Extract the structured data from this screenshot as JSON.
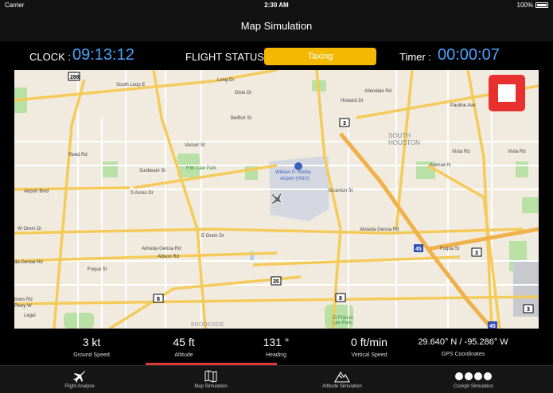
{
  "status_bar": {
    "carrier": "Carrier",
    "time": "2:30 AM",
    "battery": "100%"
  },
  "nav": {
    "title": "Map Simulation"
  },
  "info": {
    "clock_label": "CLOCK :",
    "clock_value": "09:13:12",
    "flight_status_label": "FLIGHT STATUS :",
    "flight_status_value": "Taxing",
    "timer_label": "Timer :",
    "timer_value": "00:00:07"
  },
  "map": {
    "labels": {
      "allendale": "Allendale Rd",
      "pauline": "Pauline Ave",
      "south_houston": "SOUTH\nHOUSTON",
      "vista": "Vista Rd",
      "avenue_n": "Avenue N",
      "airport_name_1": "William P. Hobby",
      "airport_name_2": "Airport (HOU)",
      "scranton": "Scranton St",
      "airport_blvd": "Airport Blvd",
      "reed": "Reed Rd",
      "sunbeam": "Sunbeam St",
      "law_park": "F.M. Law Park",
      "vasser": "Vasser St",
      "s_acres": "S Acres Dr",
      "w_orem": "W Orem Dr",
      "e_orem": "E Orem Dr",
      "almeda_genoa": "Almeda Genoa Rd",
      "allison": "Allison Rd",
      "fuqua": "Fuqua St",
      "genoa_rd": "da Genoa Rd",
      "fuqua_e": "Fuqua St",
      "el_franco": "El Franco\nLee Park",
      "brookside": "BROOKSIDE",
      "legal": "Legal",
      "south_loop": "South Loop E",
      "dixie": "Dixie Dr",
      "long_dr": "Long Dr",
      "bellfort": "Bellfort St",
      "howard": "Howard Dr",
      "almeda_genoa_e": "Almeda Genoa Rd",
      "pawy": "Pkwy W",
      "follows": "llows Rd"
    },
    "shields": [
      "288",
      "3",
      "35",
      "8",
      "8",
      "3",
      "3",
      "45",
      "45"
    ]
  },
  "stats": {
    "ground_speed_value": "3 kt",
    "ground_speed_label": "Ground Speed",
    "altitude_value": "45 ft",
    "altitude_label": "Altitude",
    "heading_value": "131 °",
    "heading_label": "Heading",
    "vertical_speed_value": "0 ft/min",
    "vertical_speed_label": "Vertical Speed",
    "gps_value": "29.640° N  /  -95.286° W",
    "gps_label": "GPS Coordinates"
  },
  "tabs": {
    "flight_analyse": "Flight Analyse",
    "map_simulation": "Map Simulation",
    "altitude_simulation": "Altitude Simulation",
    "cockpit_simulation": "Cockpit Simulation"
  },
  "colors": {
    "accent_blue": "#4aa3ff",
    "status_yellow": "#f5b800",
    "stop_red": "#e8302f",
    "road_yellow": "#f4cb5a",
    "park_green": "#9fd68a"
  }
}
